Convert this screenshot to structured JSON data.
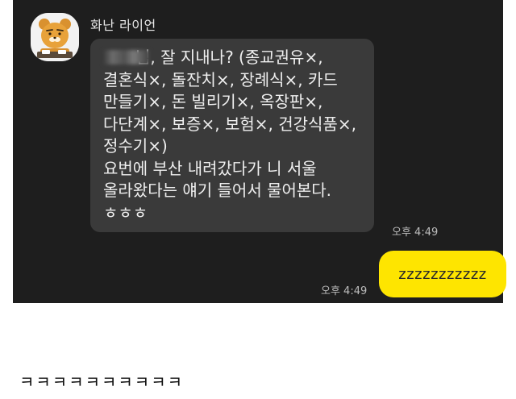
{
  "chat": {
    "background": "#1e1e1e",
    "sender_name": "화난 라이언",
    "incoming_message": {
      "lines": [
        "님, 잘 지내나? (종교권유×,",
        "결혼식×, 돌잔치×, 장례식×, 카드",
        "만들기×, 돈 빌리기×, 옥장판×,",
        "다단계×, 보증×, 보험×, 건강식품×,",
        "정수기×)",
        "요번에 부산 내려갔다가 니 서울",
        "올라왔다는 얘기 들어서 물어본다.",
        "ㅎㅎㅎ"
      ],
      "time": "오후 4:49",
      "bubble_color": "#3a3a3a"
    },
    "outgoing_message": {
      "text": "zzzzzzzzzzz",
      "time": "오후 4:49",
      "bubble_color": "#fee500"
    }
  },
  "caption": "ㅋㅋㅋㅋㅋㅋㅋㅋㅋㅋ",
  "icons": {
    "avatar": "ryan-character-avatar",
    "redaction": "blurred-name-redaction"
  }
}
